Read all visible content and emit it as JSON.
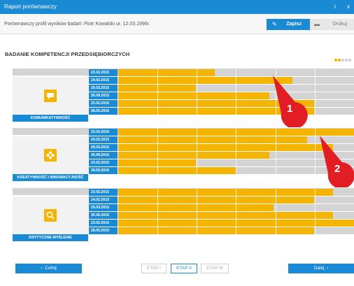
{
  "window": {
    "title": "Raport porównawczy",
    "info_glyph": "i",
    "close_glyph": "x"
  },
  "header": {
    "subtitle": "Porównawczy profil wyników badań: Piotr Kowalski ur. 12.03.1996r."
  },
  "toolbar": {
    "save_label": "Zapisz",
    "print_label": "Drukuj",
    "save_icon": "pencil-icon",
    "print_icon": "printer-icon"
  },
  "section": {
    "title": "BADANIE KOMPETENCJI PRZEDSIĘBIORCZYCH"
  },
  "colors": {
    "accent": "#1b8ad4",
    "bar": "#f5b400",
    "track": "#d3d3d3",
    "marker": "#e01e24"
  },
  "competencies": [
    {
      "label": "KOMUNIKATYWNOŚĆ",
      "icon": "speech-bubble-icon",
      "rows": [
        {
          "date": "23.02.2015",
          "value": 0.41
        },
        {
          "date": "24.02.2015",
          "value": 0.74
        },
        {
          "date": "29.03.2015",
          "value": 0.33
        },
        {
          "date": "30.09.2015",
          "value": 0.64
        },
        {
          "date": "23.02.2016",
          "value": 0.83
        },
        {
          "date": "28.05.2016",
          "value": 0.83
        }
      ]
    },
    {
      "label": "KREATYWNOŚĆ I INNOWACYJNOŚĆ",
      "icon": "flower-icon",
      "rows": [
        {
          "date": "23.02.2016",
          "value": 1.0
        },
        {
          "date": "24.02.2015",
          "value": 0.8
        },
        {
          "date": "29.03.2015",
          "value": 0.91
        },
        {
          "date": "30.09.2015",
          "value": 0.64
        },
        {
          "date": "23.02.2016",
          "value": 0.33
        },
        {
          "date": "28.05.2016",
          "value": 0.5
        }
      ]
    },
    {
      "label": "KRYTYCZNE MYŚLENIE",
      "icon": "magnifier-icon",
      "rows": [
        {
          "date": "23.02.2015",
          "value": 0.91
        },
        {
          "date": "24.02.2015",
          "value": 0.83
        },
        {
          "date": "29.03.2015",
          "value": 0.66
        },
        {
          "date": "30.06.2015",
          "value": 0.91
        },
        {
          "date": "23.02.2016",
          "value": 1.0
        },
        {
          "date": "28.05.2016",
          "value": 0.83
        }
      ]
    }
  ],
  "markers": [
    "1",
    "2"
  ],
  "navigation": {
    "back_label": "Cofnij",
    "next_label": "Dalej",
    "stages": [
      {
        "label": "ETAP I",
        "active": false
      },
      {
        "label": "ETAP II",
        "active": true
      },
      {
        "label": "ETAP III",
        "active": false
      }
    ]
  }
}
